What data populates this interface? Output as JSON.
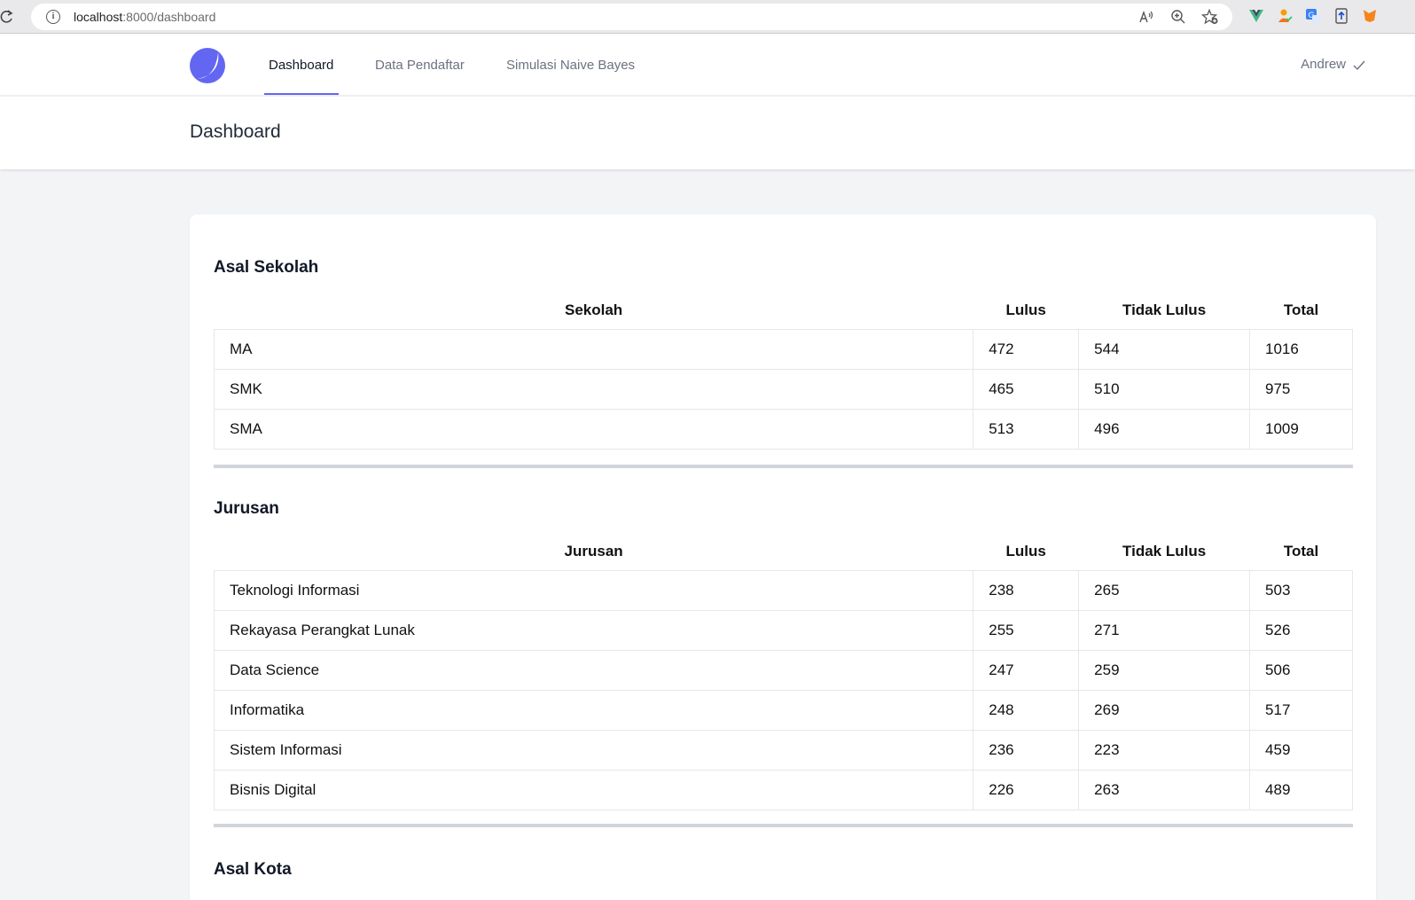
{
  "browser": {
    "url_host": "localhost",
    "url_path": ":8000/dashboard"
  },
  "nav": {
    "items": [
      {
        "label": "Dashboard",
        "active": true
      },
      {
        "label": "Data Pendaftar",
        "active": false
      },
      {
        "label": "Simulasi Naive Bayes",
        "active": false
      }
    ],
    "user_name": "Andrew",
    "accent_color": "#6366f1"
  },
  "header": {
    "title": "Dashboard"
  },
  "sections": {
    "asal_sekolah": {
      "title": "Asal Sekolah",
      "columns": [
        "Sekolah",
        "Lulus",
        "Tidak Lulus",
        "Total"
      ],
      "rows": [
        [
          "MA",
          "472",
          "544",
          "1016"
        ],
        [
          "SMK",
          "465",
          "510",
          "975"
        ],
        [
          "SMA",
          "513",
          "496",
          "1009"
        ]
      ]
    },
    "jurusan": {
      "title": "Jurusan",
      "columns": [
        "Jurusan",
        "Lulus",
        "Tidak Lulus",
        "Total"
      ],
      "rows": [
        [
          "Teknologi Informasi",
          "238",
          "265",
          "503"
        ],
        [
          "Rekayasa Perangkat Lunak",
          "255",
          "271",
          "526"
        ],
        [
          "Data Science",
          "247",
          "259",
          "506"
        ],
        [
          "Informatika",
          "248",
          "269",
          "517"
        ],
        [
          "Sistem Informasi",
          "236",
          "223",
          "459"
        ],
        [
          "Bisnis Digital",
          "226",
          "263",
          "489"
        ]
      ]
    },
    "asal_kota": {
      "title": "Asal Kota"
    }
  }
}
